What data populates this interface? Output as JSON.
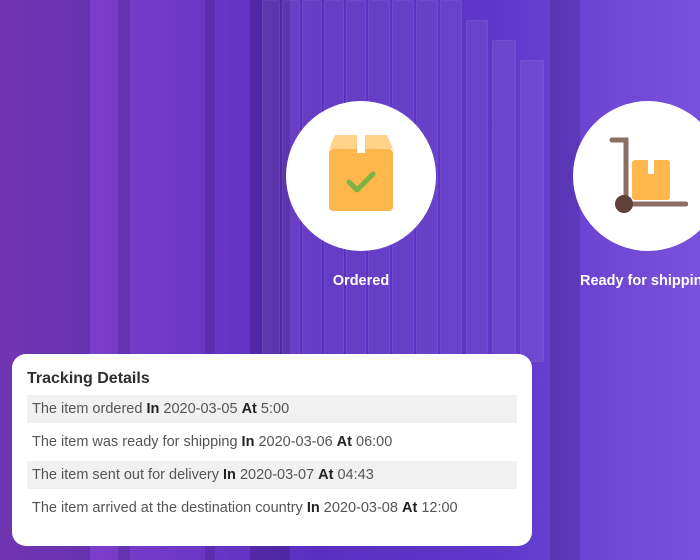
{
  "steps": [
    {
      "label": "Ordered",
      "icon": "package-check-icon"
    },
    {
      "label": "Ready for shipping",
      "icon": "hand-truck-icon"
    }
  ],
  "tracking": {
    "title": "Tracking Details",
    "in_label": "In",
    "at_label": "At",
    "rows": [
      {
        "text": "The item ordered",
        "date": "2020-03-05",
        "time": "5:00"
      },
      {
        "text": "The item was ready for shipping",
        "date": "2020-03-06",
        "time": "06:00"
      },
      {
        "text": "The item sent out for delivery",
        "date": "2020-03-07",
        "time": "04:43"
      },
      {
        "text": "The item arrived at the destination country",
        "date": "2020-03-08",
        "time": "12:00"
      }
    ]
  },
  "colors": {
    "background_purple": "#6a3fd0",
    "box_orange": "#ffb74d",
    "check_green": "#7cb342",
    "truck_brown": "#8d6e63"
  }
}
